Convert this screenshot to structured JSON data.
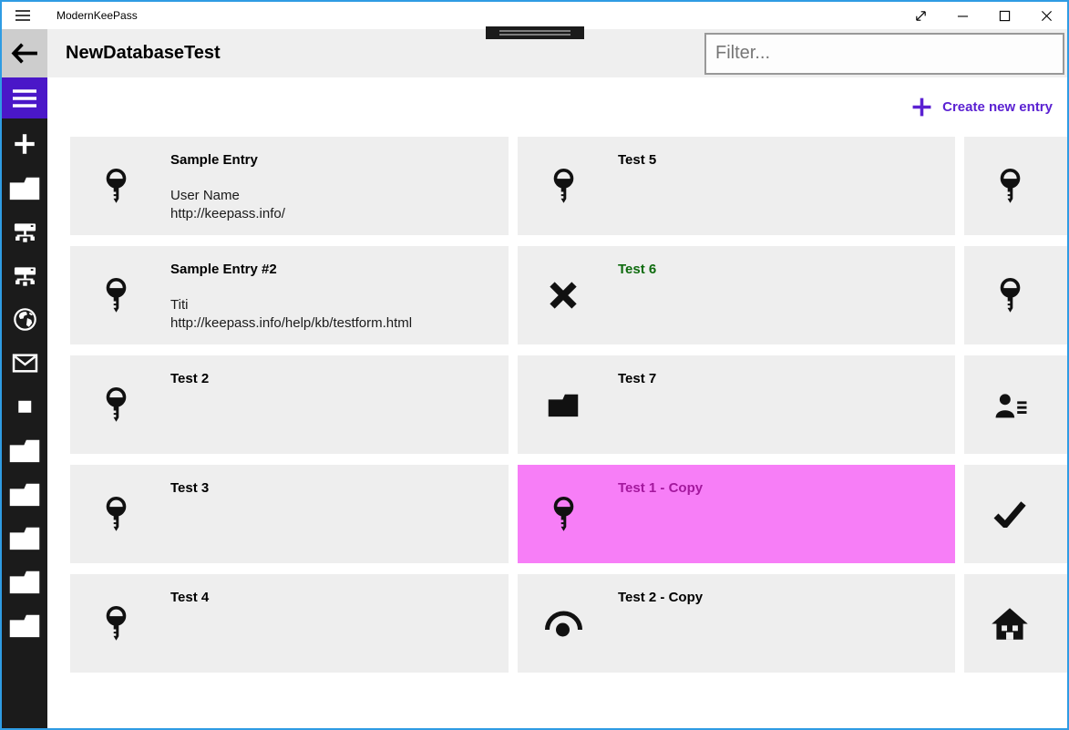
{
  "window": {
    "title": "ModernKeePass",
    "menu_icon": "titlebar-menu-icon",
    "controls": [
      {
        "name": "fullscreen",
        "icon": "diagonal-resize-icon"
      },
      {
        "name": "minimize",
        "icon": "minimize-icon"
      },
      {
        "name": "maximize",
        "icon": "maximize-icon"
      },
      {
        "name": "close",
        "icon": "close-icon"
      }
    ]
  },
  "header": {
    "back_icon": "back-arrow-icon",
    "database_title": "NewDatabaseTest",
    "filter": {
      "placeholder": "Filter...",
      "value": ""
    }
  },
  "nav": {
    "menu_icon": "hamburger-icon",
    "items": [
      {
        "icon": "plus-icon"
      },
      {
        "icon": "folder-icon"
      },
      {
        "icon": "network-icon"
      },
      {
        "icon": "network-icon"
      },
      {
        "icon": "globe-icon"
      },
      {
        "icon": "mail-icon"
      },
      {
        "icon": "square-icon"
      },
      {
        "icon": "folder-icon"
      },
      {
        "icon": "folder-icon"
      },
      {
        "icon": "folder-icon"
      },
      {
        "icon": "folder-icon"
      },
      {
        "icon": "folder-icon"
      }
    ]
  },
  "toolbar": {
    "plus_icon": "create-plus-icon",
    "create_label": "Create new entry"
  },
  "entries": {
    "columns": 3,
    "cards": [
      {
        "icon": "key-icon",
        "title": "Sample Entry",
        "details": [
          "User Name",
          "http://keepass.info/"
        ]
      },
      {
        "icon": "key-icon",
        "title": "Test 5",
        "details": []
      },
      {
        "icon": "key-icon",
        "title": "",
        "details": [],
        "clipped": true
      },
      {
        "icon": "key-icon",
        "title": "Sample Entry #2",
        "details": [
          "Titi",
          "http://keepass.info/help/kb/testform.html"
        ]
      },
      {
        "icon": "x-icon",
        "title": "Test 6",
        "details": [],
        "title_color": "#0e6b0e"
      },
      {
        "icon": "key-icon",
        "title": "",
        "details": [],
        "clipped": true
      },
      {
        "icon": "key-icon",
        "title": "Test 2",
        "details": []
      },
      {
        "icon": "folder-icon",
        "title": "Test 7",
        "details": []
      },
      {
        "icon": "contact-list-icon",
        "title": "",
        "details": [],
        "clipped": true
      },
      {
        "icon": "key-icon",
        "title": "Test 3",
        "details": []
      },
      {
        "icon": "key-icon",
        "title": "Test 1 - Copy",
        "details": [],
        "selected": true,
        "title_color": "#a3189d"
      },
      {
        "icon": "check-icon",
        "title": "",
        "details": [],
        "clipped": true
      },
      {
        "icon": "key-icon",
        "title": "Test 4",
        "details": []
      },
      {
        "icon": "eye-icon",
        "title": "Test 2 - Copy",
        "details": []
      },
      {
        "icon": "home-icon",
        "title": "",
        "details": [],
        "clipped": true
      }
    ]
  },
  "colors": {
    "window_border": "#2f9ce3",
    "accent_purple": "#4a17c8",
    "create_button_purple": "#5b21d2",
    "selected_background": "#f77ef7",
    "selected_title": "#a3189d",
    "green_title": "#0e6b0e",
    "card_background": "#eeeeee",
    "sidebar_background": "#1b1b1b",
    "header_background": "#efefef"
  }
}
